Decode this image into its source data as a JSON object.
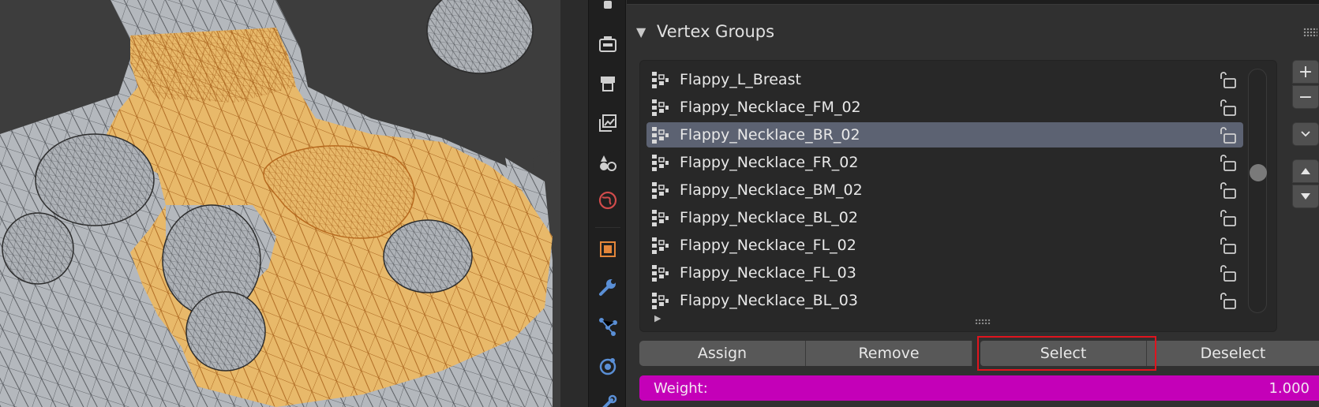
{
  "viewport": {
    "mesh_color": "#b4b8bd",
    "selected_color": "#e8b96a",
    "wire_selected": "#c07020"
  },
  "tabs": [
    {
      "icon": "tool-icon"
    },
    {
      "icon": "render-icon"
    },
    {
      "icon": "output-icon"
    },
    {
      "icon": "view-layer-icon"
    },
    {
      "icon": "scene-icon"
    },
    {
      "icon": "world-icon"
    },
    {
      "icon": "object-icon"
    },
    {
      "icon": "modifier-icon"
    },
    {
      "icon": "particles-icon"
    },
    {
      "icon": "physics-icon"
    },
    {
      "icon": "constraints-icon"
    }
  ],
  "section": {
    "title": "Vertex Groups",
    "expanded": true
  },
  "vertex_groups": [
    {
      "name": "Flappy_L_Breast",
      "selected": false
    },
    {
      "name": "Flappy_Necklace_FM_02",
      "selected": false
    },
    {
      "name": "Flappy_Necklace_BR_02",
      "selected": true
    },
    {
      "name": "Flappy_Necklace_FR_02",
      "selected": false
    },
    {
      "name": "Flappy_Necklace_BM_02",
      "selected": false
    },
    {
      "name": "Flappy_Necklace_BL_02",
      "selected": false
    },
    {
      "name": "Flappy_Necklace_FL_02",
      "selected": false
    },
    {
      "name": "Flappy_Necklace_FL_03",
      "selected": false
    },
    {
      "name": "Flappy_Necklace_BL_03",
      "selected": false
    }
  ],
  "side_buttons": {
    "add": "+",
    "remove": "−"
  },
  "actions": {
    "assign": "Assign",
    "remove": "Remove",
    "select": "Select",
    "deselect": "Deselect"
  },
  "weight": {
    "label": "Weight:",
    "value": "1.000",
    "color": "#c400b8"
  },
  "highlight_color": "#e0141e"
}
